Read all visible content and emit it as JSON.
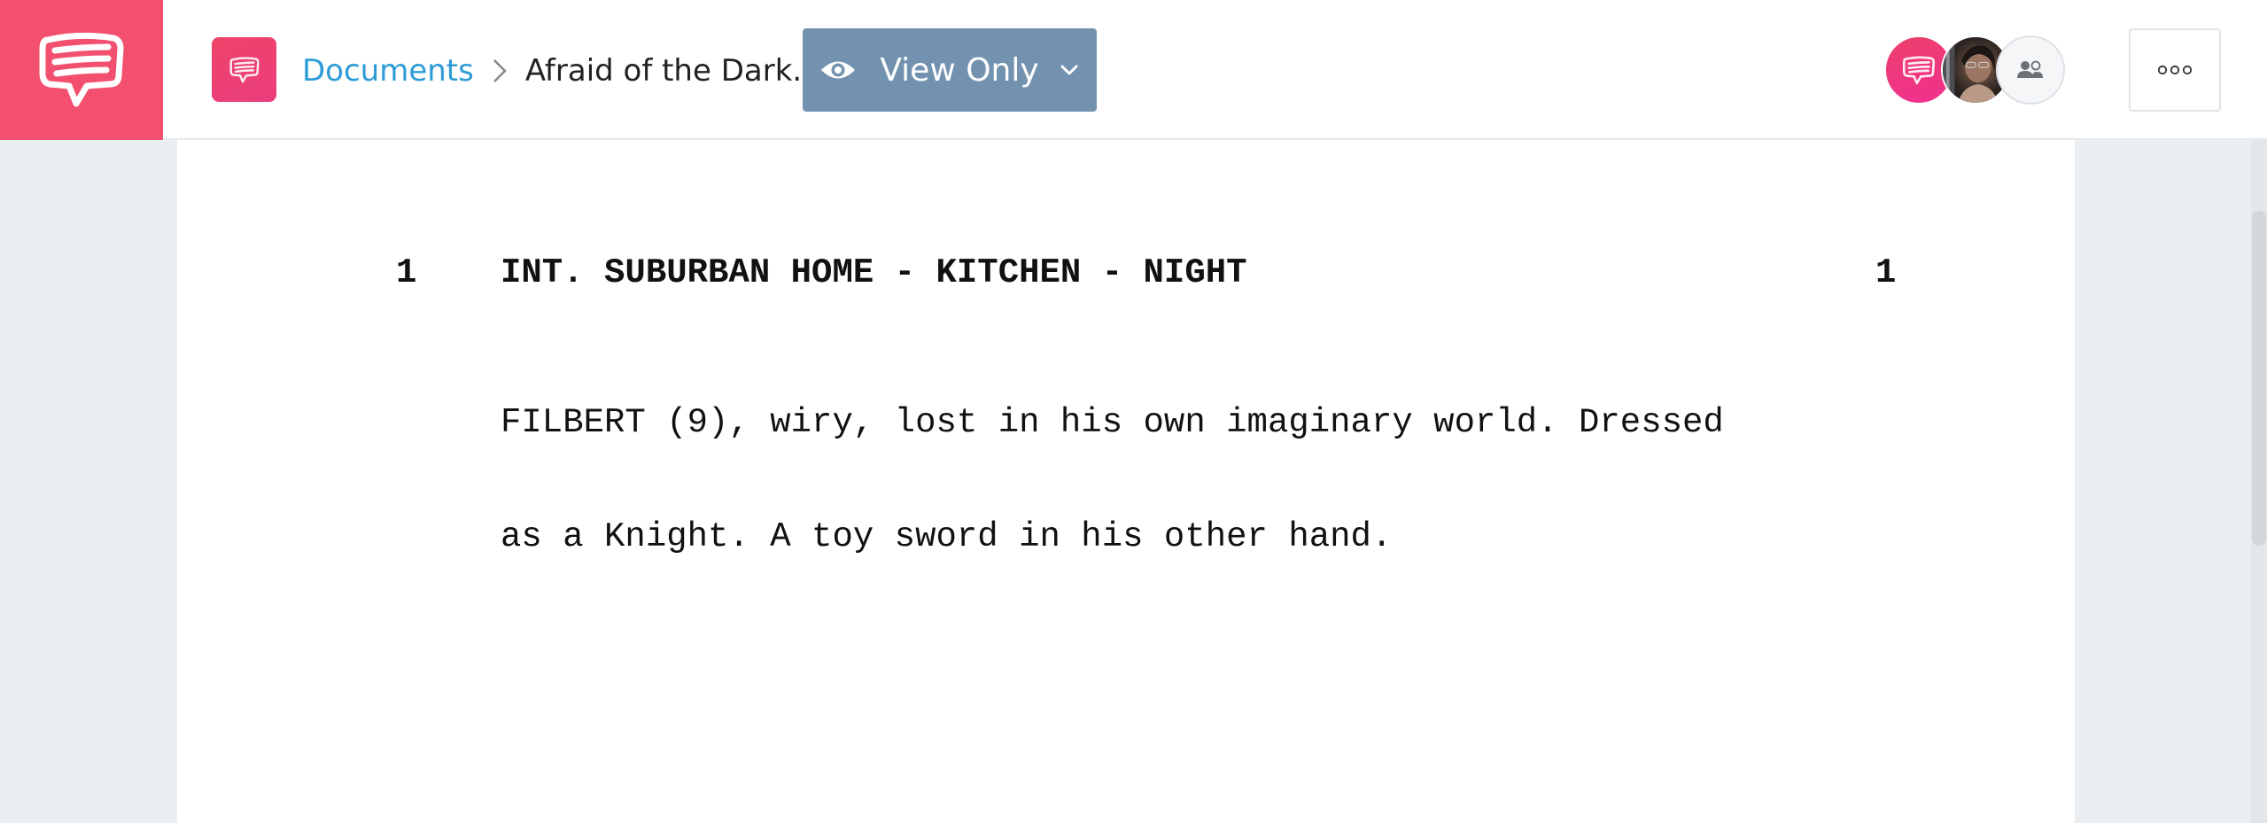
{
  "header": {
    "logo_icon": "speech-bubble-icon",
    "doc_badge_icon": "speech-bubble-icon",
    "breadcrumb": {
      "parent": "Documents",
      "separator_icon": "chevron-right-icon",
      "current": "Afraid of the Dark.."
    },
    "view_mode": {
      "icon": "eye-icon",
      "label": "View Only",
      "dropdown_icon": "chevron-down-icon"
    },
    "collaborators": [
      {
        "type": "brand",
        "icon": "speech-bubble-icon"
      },
      {
        "type": "photo",
        "icon": "user-avatar"
      },
      {
        "type": "share",
        "icon": "people-icon"
      }
    ],
    "more_icon": "ellipsis-icon"
  },
  "script": {
    "scene_number_left": "1",
    "scene_number_right": "1",
    "scene_heading": "INT. SUBURBAN HOME - KITCHEN - NIGHT",
    "action_lines": [
      "FILBERT (9), wiry, lost in his own imaginary world. Dressed",
      "as a Knight. A toy sword in his other hand."
    ]
  },
  "colors": {
    "brand_pink": "#F2506E",
    "link_blue": "#2D9CD6",
    "view_button": "#7392AF",
    "background": "#EBEEF1"
  }
}
